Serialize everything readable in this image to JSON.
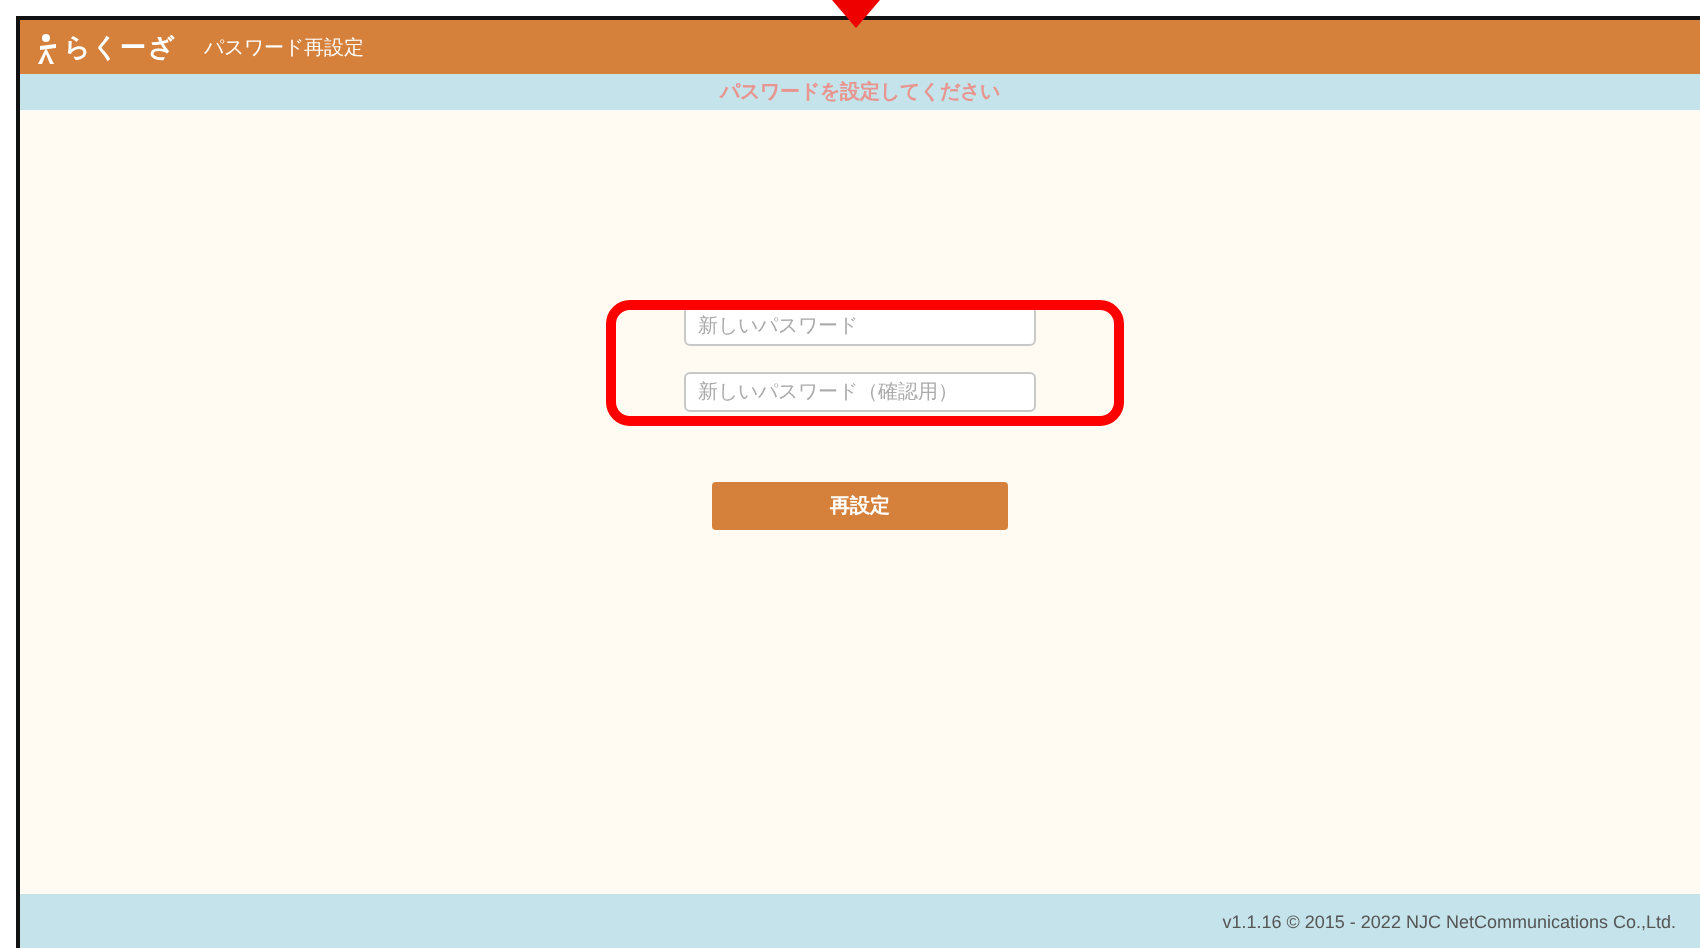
{
  "header": {
    "logo": "らくーざ",
    "title": "パスワード再設定"
  },
  "banner": "パスワードを設定してください",
  "form": {
    "fields": [
      {
        "placeholder": "新しいパスワード"
      },
      {
        "placeholder": "新しいパスワード（確認用）"
      }
    ],
    "button": "再設定"
  },
  "footer": "v1.1.16 © 2015 - 2022 NJC NetCommunications Co.,Ltd."
}
